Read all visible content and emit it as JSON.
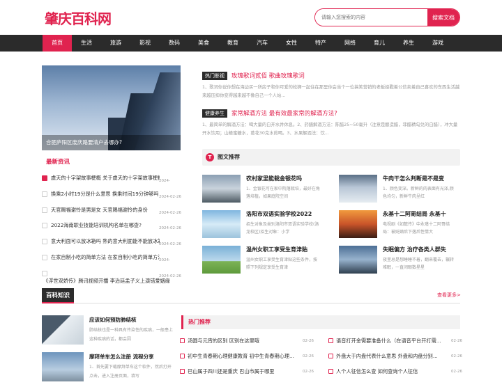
{
  "site": {
    "logo": "肇庆百科网"
  },
  "search": {
    "placeholder": "请输入您搜索的内容",
    "button": "搜索文档"
  },
  "nav": [
    "首页",
    "生活",
    "旅游",
    "影视",
    "数码",
    "美食",
    "教育",
    "汽车",
    "女性",
    "特产",
    "网络",
    "育儿",
    "养生",
    "游戏"
  ],
  "hero": {
    "caption": "合肥庐阳区废庆路要清户去哪办?"
  },
  "latest": {
    "title": "最新资讯",
    "items": [
      {
        "text": "虞天的十字架故事梗概 关于虞天的十字架故事梗概",
        "date": "2024-"
      },
      {
        "text": "换乘2小时19分是什么意思 换乘时间19分钟够吗",
        "date": "2024-02-26"
      },
      {
        "text": "天官赐福谢怜是男是女 天官赐福谢怜的身份",
        "date": "2024-02-26"
      },
      {
        "text": "2022海南职业技能培训机构名单在哪查?",
        "date": "2024-02-26"
      },
      {
        "text": "意大利面可以放冰箱吗 熟的意大利面能不能放冰箱储存",
        "date": "2024-02-26"
      },
      {
        "text": "在家自制小吃的简单方法 在家自制小吃的简单方法视频",
        "date": "2024-"
      },
      {
        "text": "",
        "date": "2024-02-26"
      }
    ],
    "last": "《浮世双娇传》腾讯视频开播 李治廷孟子义上演错爱姻缘"
  },
  "featured": [
    {
      "tag": "热门影视",
      "title": "玫瑰歌词贰佰 歌曲玫瑰歌词",
      "desc": "1、歌词你说你想在海边买一所房子和你可爱的松狮一起住在那里你会当个一位搞笑营销的老板娘戳着公信卖着自己喜欢的东西生活越来越压抑你变得越来越不像自己一个人站..."
    },
    {
      "tag": "健康养生",
      "title": "家常解酒方法 最有效最家常的解酒方法?",
      "desc": "1、最简单的解酒方法：喝大量的白开水并休息。2、药膳解酒方法：陈醋25~50毫升（注意是酿造醋，菲醋精勾兑的白醋），冲大量开水饮用；山楂蜜糖水，葛花30克水煎喝。3、水果解酒法：饮..."
    }
  ],
  "tuwen": {
    "title": "图文推荐",
    "items": [
      {
        "title": "农村家里能栽金银花吗",
        "desc": "1、金银花可在家中院落栽培，最好在角落培植，如果庭院空间"
      },
      {
        "title": "牛肉干怎么判断是不是变",
        "desc": "1、颜色变深。新鲜的肉表面有光泽,颜色均匀，新鲜牛肉呈红"
      },
      {
        "title": "洛阳市双语实验学校2022",
        "desc": "招生对象及类别洛阳市双语实验学校(洛龙校区)招生对象：小学"
      },
      {
        "title": "永基十二阿哥结局 永基十",
        "desc": "电视剧《如懿传》中永璂十二阿哥结局：被贬嫡后下落后性情大"
      },
      {
        "title": "温州女职工享受生育津贴",
        "desc": "温州女职工享受生育津贴这些条件，按照下列规定享受生育津"
      },
      {
        "title": "失眠偏方 治疗各类人群失",
        "desc": "夜里总是想睡睡不着，翻来覆去，辗转难眠，一直闭眼数星星"
      }
    ]
  },
  "more": "查看更多>",
  "baike": {
    "title": "百科知识",
    "items": [
      {
        "title": "应该如何预防肺结核",
        "desc": "肺结核也是一种具有传染性的疾病，一般患上这种疾病的话，都会因"
      },
      {
        "title": "摩拜单车怎么注册 流程分享",
        "desc": "1、首先要下载摩拜单车这个软件，然后打开点击，进入注册页面，填写"
      }
    ]
  },
  "hot": {
    "title": "热门推荐",
    "items": [
      {
        "text": "汤圆与元宵的区别 区别在这里哦",
        "date": "02-26"
      },
      {
        "text": "语音打开金需要准备什么（在语音平台开打需...",
        "date": "02-26"
      },
      {
        "text": "初中生青春期心理健康教育 初中生青春期心理...",
        "date": "02-26"
      },
      {
        "text": "外盘大于内盘代表什么意思 外盘和内盘分别...",
        "date": "02-26"
      },
      {
        "text": "巴山属于四川还是重庆 巴山市属于哪里",
        "date": "02-26"
      },
      {
        "text": "人个人征信怎么查 如何查询个人征信",
        "date": "02-26"
      }
    ]
  },
  "colors": {
    "accent": "#e0234f",
    "nav_bg": "#2b2b2b"
  }
}
